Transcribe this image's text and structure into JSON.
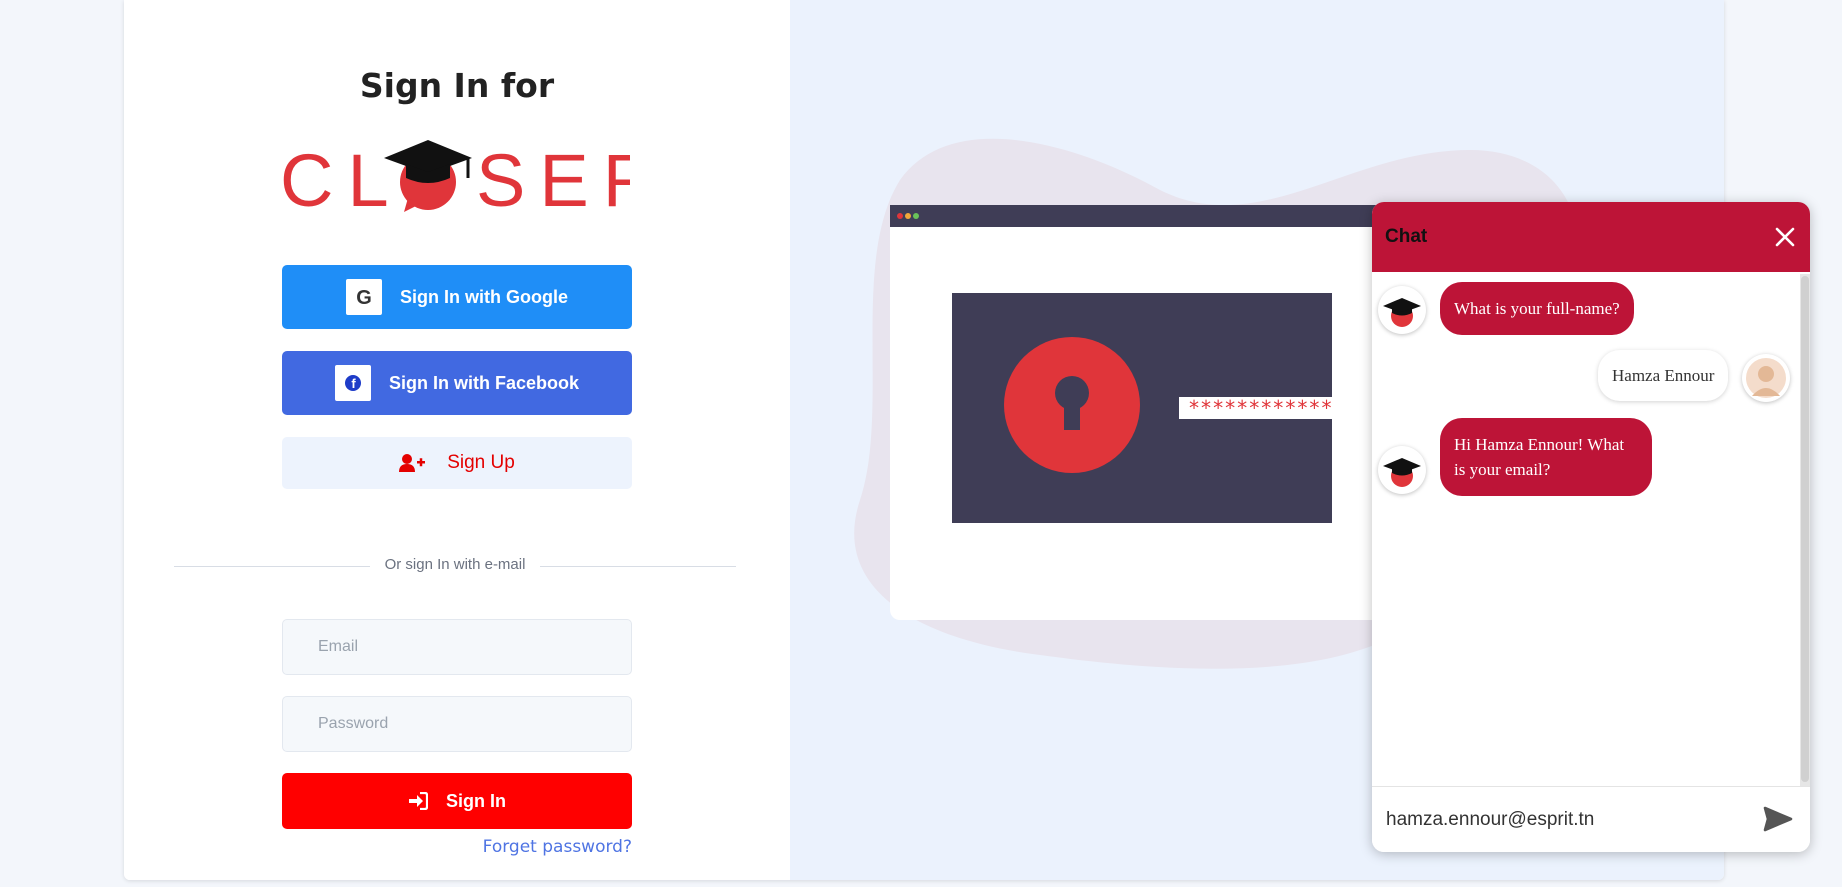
{
  "login": {
    "title": "Sign In for",
    "logo_text": "CLOSER",
    "google_label": "Sign In with Google",
    "facebook_label": "Sign In with Facebook",
    "signup_label": "Sign Up",
    "divider_text": "Or sign In with e-mail",
    "email_placeholder": "Email",
    "password_placeholder": "Password",
    "signin_label": "Sign In",
    "forgot_label": "Forget password?"
  },
  "illustration": {
    "password_mask": "************"
  },
  "chat": {
    "title": "Chat",
    "messages": [
      {
        "from": "bot",
        "text": "What is your full-name?"
      },
      {
        "from": "user",
        "text": "Hamza Ennour"
      },
      {
        "from": "bot",
        "text": "Hi Hamza Ennour! What is your email?"
      }
    ],
    "input_value": "hamza.ennour@esprit.tn"
  },
  "colors": {
    "brand_red": "#e0353a",
    "google_blue": "#1f8ef7",
    "facebook_blue": "#4169e1",
    "signin_red": "#ff0000",
    "chat_header": "#bd1437"
  }
}
